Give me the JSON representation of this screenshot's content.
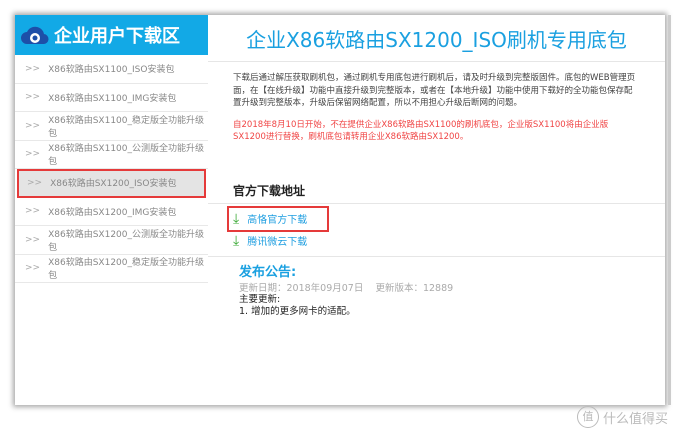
{
  "sidebar": {
    "title": "企业用户下载区",
    "chevron": ">>",
    "items": [
      {
        "label": "X86软路由SX1100_ISO安装包"
      },
      {
        "label": "X86软路由SX1100_IMG安装包"
      },
      {
        "label": "X86软路由SX1100_稳定版全功能升级包"
      },
      {
        "label": "X86软路由SX1100_公测版全功能升级包"
      },
      {
        "label": "X86软路由SX1200_ISO安装包",
        "selected": true
      },
      {
        "label": "X86软路由SX1200_IMG安装包"
      },
      {
        "label": "X86软路由SX1200_公测版全功能升级包"
      },
      {
        "label": "X86软路由SX1200_稳定版全功能升级包"
      }
    ]
  },
  "main": {
    "title": "企业X86软路由SX1200_ISO刷机专用底包",
    "intro": "下载后通过解压获取刷机包，通过刷机专用底包进行刷机后，请及时升级到完整版固件。底包的WEB管理页面，在【在线升级】功能中直接升级到完整版本，或者在【本地升级】功能中使用下载好的全功能包保存配置升级到完整版本，升级后保留网络配置，所以不用担心升级后断网的问题。",
    "notice_red": "自2018年8月10日开始，不在提供企业X86软路由SX1100的刷机底包，企业版SX1100将由企业版SX1200进行替换，刷机底包请转用企业X86软路由SX1200。",
    "download_heading": "官方下载地址",
    "downloads": [
      {
        "label": "高恪官方下载"
      },
      {
        "label": "腾讯微云下载"
      }
    ],
    "announcement": {
      "title": "发布公告:",
      "date": "更新日期：2018年09月07日",
      "version": "更新版本：12889",
      "main_label": "主要更新:",
      "items": [
        "1. 增加的更多网卡的适配。"
      ]
    }
  },
  "watermark": {
    "icon": "值",
    "text": "什么值得买"
  }
}
